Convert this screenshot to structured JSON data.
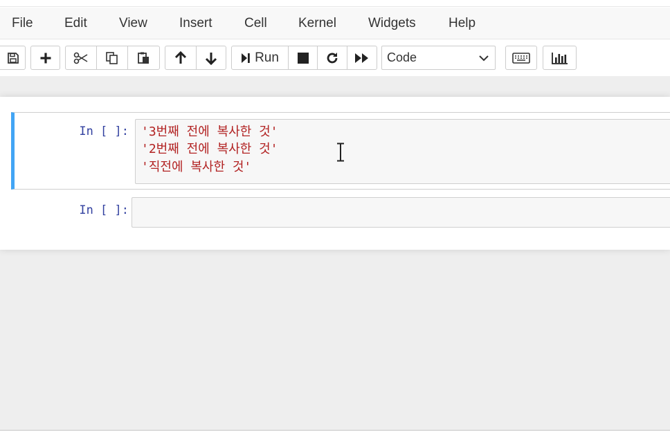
{
  "menubar": {
    "items": [
      {
        "label": "File"
      },
      {
        "label": "Edit"
      },
      {
        "label": "View"
      },
      {
        "label": "Insert"
      },
      {
        "label": "Cell"
      },
      {
        "label": "Kernel"
      },
      {
        "label": "Widgets"
      },
      {
        "label": "Help"
      }
    ]
  },
  "toolbar": {
    "run_label": "Run",
    "cell_type_selected": "Code",
    "icons": [
      "save-icon",
      "plus-icon",
      "scissors-icon",
      "copy-icon",
      "paste-icon",
      "arrow-up-icon",
      "arrow-down-icon",
      "step-forward-icon",
      "stop-icon",
      "restart-icon",
      "fast-forward-icon",
      "keyboard-icon",
      "bar-chart-icon"
    ]
  },
  "cells": [
    {
      "prompt": "In [ ]:",
      "lines": [
        "'3번째 전에 복사한 것'",
        "'2번째 전에 복사한 것'",
        "'직전에 복사한 것'"
      ]
    },
    {
      "prompt": "In [ ]:",
      "lines": []
    }
  ],
  "colors": {
    "selected_cell_border": "#42a5f5",
    "prompt": "#303f9f",
    "string_literal": "#b22222"
  }
}
